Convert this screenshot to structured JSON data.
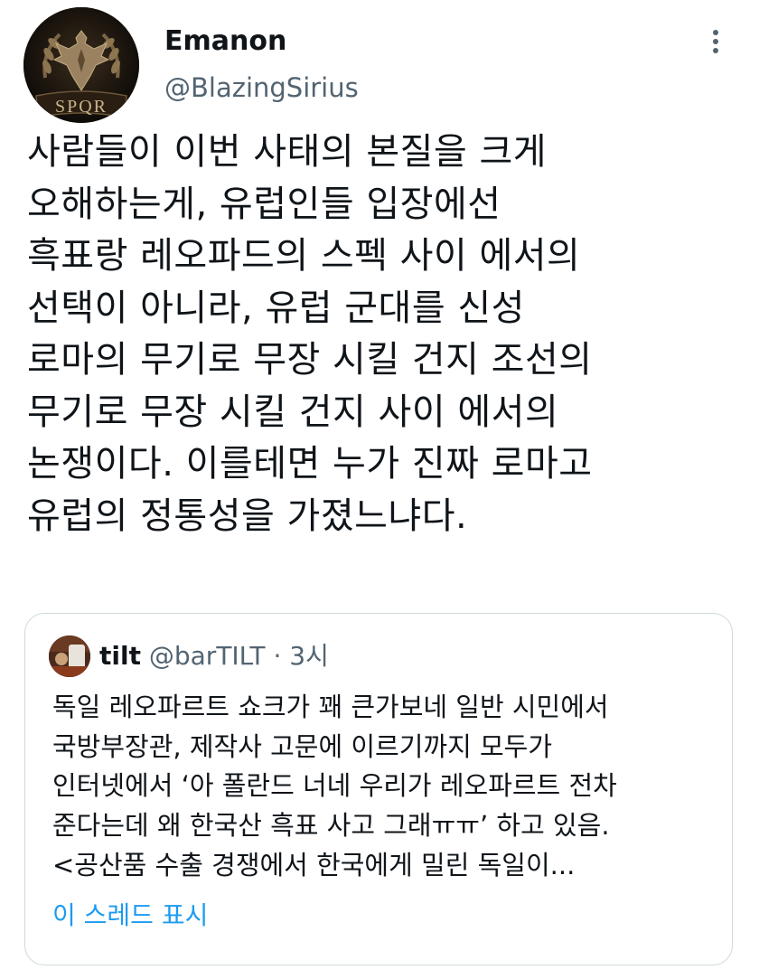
{
  "author": {
    "display_name": "Emanon",
    "handle": "@BlazingSirius",
    "avatar_text": "SPQR",
    "avatar_icon": "spqr-eagle-icon"
  },
  "menu_icon": "more-vertical-icon",
  "body_lines": [
    "사람들이 이번 사태의 본질을 크게",
    "오해하는게, 유럽인들 입장에선",
    "흑표랑 레오파드의 스펙 사이 에서의",
    "선택이 아니라, 유럽 군대를 신성",
    "로마의 무기로 무장 시킬 건지 조선의",
    "무기로 무장 시킬 건지 사이 에서의",
    "논쟁이다. 이를테면 누가 진짜 로마고",
    "유럽의 정통성을 가졌느냐다."
  ],
  "quoted_tweet": {
    "display_name": "tilt",
    "handle": "@barTILT",
    "separator": "·",
    "time": "3시",
    "text_lines": [
      "독일 레오파르트 쇼크가 꽤 큰가보네 일반 시민에서",
      "국방부장관, 제작사 고문에 이르기까지 모두가",
      "인터넷에서 ‘아 폴란드 너네 우리가 레오파르트 전차",
      "준다는데 왜 한국산 흑표 사고 그래ㅠㅠ’ 하고 있음.",
      "<공산품 수출 경쟁에서 한국에게 밀린 독일이..."
    ],
    "show_thread_label": "이 스레드 표시"
  },
  "colors": {
    "text": "#0f1419",
    "secondary": "#536471",
    "link": "#1d9bf0",
    "border": "#cfd9de"
  }
}
